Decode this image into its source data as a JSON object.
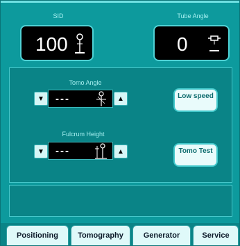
{
  "sid": {
    "label": "SID",
    "value": "100",
    "icon": "sid-icon"
  },
  "tube_angle": {
    "label": "Tube Angle",
    "value": "0",
    "icon": "tube-icon"
  },
  "tomo_angle": {
    "label": "Tomo Angle",
    "value": "---",
    "icon": "angle-icon"
  },
  "fulcrum_height": {
    "label": "Fulcrum Height",
    "value": "---",
    "icon": "fulcrum-icon"
  },
  "buttons": {
    "low_speed": "Low speed",
    "tomo_test": "Tomo Test"
  },
  "tabs": [
    {
      "label": "Positioning"
    },
    {
      "label": "Tomography"
    },
    {
      "label": "Generator"
    },
    {
      "label": "Service"
    }
  ]
}
